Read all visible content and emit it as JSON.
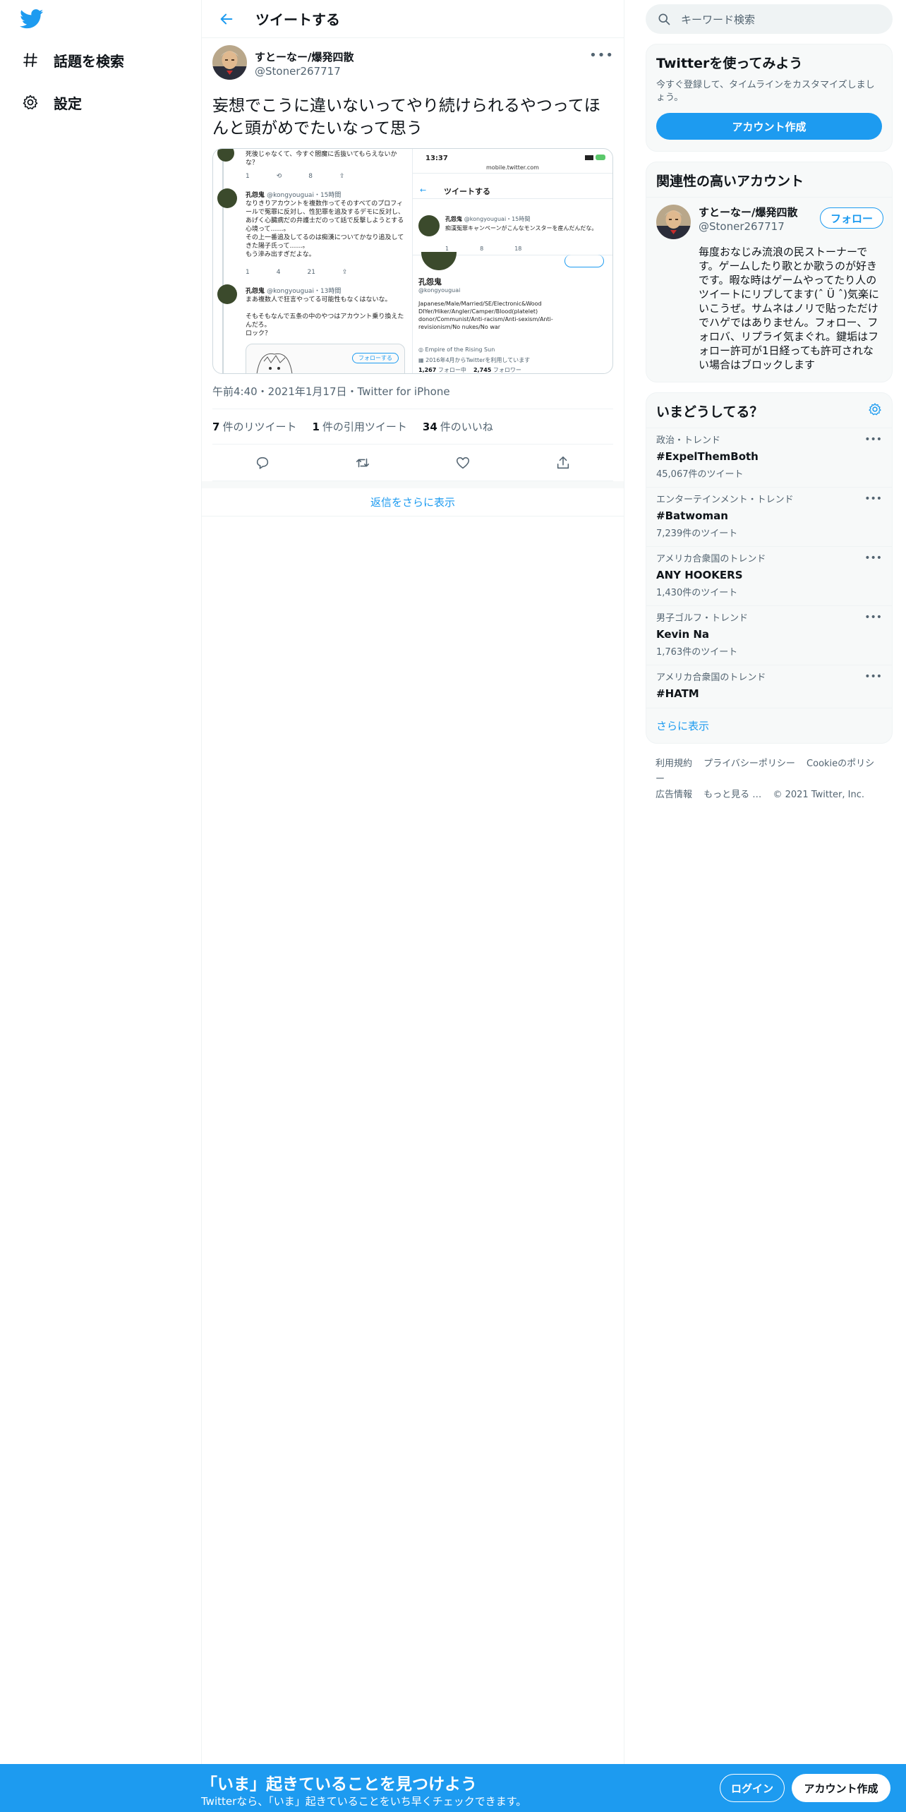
{
  "nav": {
    "explore_label": "話題を検索",
    "settings_label": "設定"
  },
  "header": {
    "title": "ツイートする"
  },
  "tweet": {
    "author_name": "すとーなー/爆発四散",
    "author_handle": "@Stoner267717",
    "text": "妄想でこうに違いないってやり続けられるやつってほんと頭がめでたいなって思う",
    "meta": "午前4:40・2021年1月17日・Twitter for iPhone",
    "retweets_count": "7",
    "retweets_label": "件のリツイート",
    "quotes_count": "1",
    "quotes_label": "件の引用ツイート",
    "likes_count": "34",
    "likes_label": "件のいいね"
  },
  "media_left": {
    "t1": "死後じゃなくて、今すぐ閻魔に舌抜いてもらえないかな？",
    "r1_reply": "1",
    "r1_like": "8",
    "p2_name": "孔怨鬼",
    "p2_handle": "@kongyouguai・15時間",
    "p2_text": "なりきりアカウントを複数作ってそのすべてのプロフィールで冤罪に反対し、性犯罪を追及するデモに反対し、あげく心臓病だの弁護士だのって話で反撃しようとする心境って……。\nその上一番追及してるのは痴漢についてかなり追及してきた陽子氏って……。\nもう滲み出すぎだよな。",
    "r2_reply": "1",
    "r2_rt": "4",
    "r2_like": "21",
    "p3_name": "孔怨鬼",
    "p3_handle": "@kongyouguai・13時間",
    "p3_text": "まあ複数人で狂言やってる可能性もなくはないな。\n\nそもそもなんで五条の中のやつはアカウント乗り換えたんだろ。\nロック？",
    "follow_label": "フォローする"
  },
  "media_right": {
    "time": "13:37",
    "url": "mobile.twitter.com",
    "title": "ツイートする",
    "q_name": "孔怨鬼",
    "q_handle": "@kongyouguai・15時間",
    "q_text": "痴漢冤罪キャンペーンがこんなモンスターを産んだんだな。",
    "q_reply": "1",
    "q_rt": "8",
    "q_like": "18",
    "profile_name": "孔怨鬼",
    "profile_handle": "@kongyouguai",
    "bio": "Japanese/Male/Married/SE/Electronic&Wood DIYer/Hiker/Angler/Camper/Blood(platelet) donor/Communist/Anti-racism/Anti-sexism/Anti-revisionism/No nukes/No war",
    "location": "Empire of the Rising Sun",
    "joined": "2016年4月からTwitterを利用しています",
    "following_count": "1,267",
    "following_label": "フォロー中",
    "followers_count": "2,745",
    "followers_label": "フォロワー"
  },
  "show_more_replies": "返信をさらに表示",
  "search": {
    "placeholder": "キーワード検索"
  },
  "signup_card": {
    "title": "Twitterを使ってみよう",
    "subtitle": "今すぐ登録して、タイムラインをカスタマイズしましょう。",
    "button": "アカウント作成"
  },
  "related_card": {
    "title": "関連性の高いアカウント",
    "name": "すとーなー/爆発四散",
    "handle": "@Stoner267717",
    "follow": "フォロー",
    "bio": "毎度おなじみ流浪の民ストーナーです。ゲームしたり歌とか歌うのが好きです。暇な時はゲームやってたり人のツイートにリプしてます(ˆ Ü ˆ)気楽にいこうぜ。サムネはノリで貼っただけでハゲではありません。フォロー、フォロバ、リプライ気まぐれ。鍵垢はフォロー許可が1日経っても許可されない場合はブロックします"
  },
  "trends_card": {
    "title": "いまどうしてる？",
    "items": [
      {
        "category": "政治・トレンド",
        "name": "#ExpelThemBoth",
        "count": "45,067件のツイート"
      },
      {
        "category": "エンターテインメント・トレンド",
        "name": "#Batwoman",
        "count": "7,239件のツイート"
      },
      {
        "category": "アメリカ合衆国のトレンド",
        "name": "ANY HOOKERS",
        "count": "1,430件のツイート"
      },
      {
        "category": "男子ゴルフ・トレンド",
        "name": "Kevin Na",
        "count": "1,763件のツイート"
      },
      {
        "category": "アメリカ合衆国のトレンド",
        "name": "#HATM",
        "count": ""
      }
    ],
    "more": "さらに表示"
  },
  "footer": {
    "terms": "利用規約",
    "privacy": "プライバシーポリシー",
    "cookie": "Cookieのポリシー",
    "ads": "広告情報",
    "more": "もっと見る …",
    "copyright": "© 2021 Twitter, Inc."
  },
  "bottom_bar": {
    "title": "「いま」起きていることを見つけよう",
    "subtitle": "Twitterなら、「いま」起きていることをいち早くチェックできます。",
    "login": "ログイン",
    "signup": "アカウント作成"
  },
  "colors": {
    "accent": "#1d9bf0",
    "text": "#0f1419",
    "muted": "#536471",
    "border": "#eff3f4"
  }
}
